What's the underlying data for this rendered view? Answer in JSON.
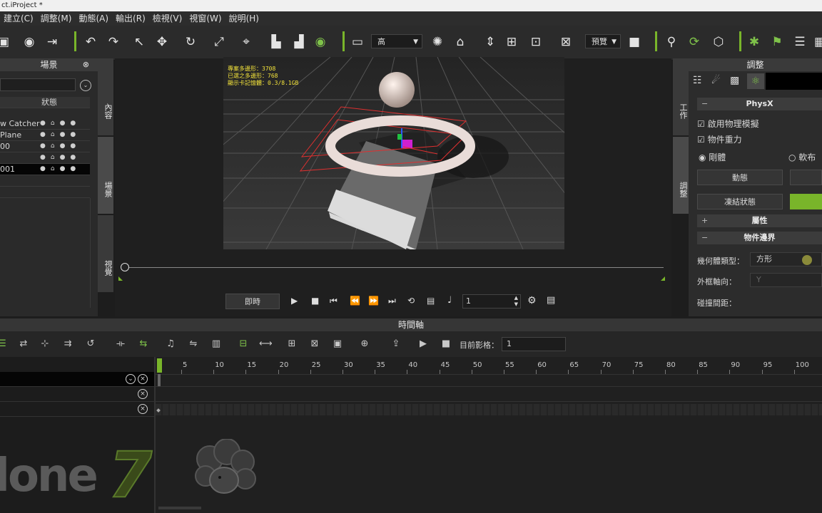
{
  "window": {
    "title": "ct.iProject *"
  },
  "menu": [
    "建立(C)",
    "調整(M)",
    "動態(A)",
    "輸出(R)",
    "檢視(V)",
    "視窗(W)",
    "說明(H)"
  ],
  "toolbar": {
    "quality_combo": "高",
    "preview_combo": "預覽"
  },
  "scene": {
    "title": "場景",
    "col_status": "狀態",
    "rows": [
      "w Catcher",
      "Plane",
      "00",
      "",
      "001"
    ]
  },
  "side_tabs": {
    "left": [
      "內容",
      "場景",
      "視覺"
    ],
    "right": [
      "工作",
      "調整"
    ]
  },
  "viewport": {
    "stats": [
      "專案多邊形：3708",
      "已選之多邊形：768",
      "顯示卡記憶體：0.3/8.1GB"
    ]
  },
  "playback": {
    "mode_button": "即時",
    "frame": "1"
  },
  "props": {
    "title": "調整",
    "physx_section": "PhysX",
    "enable_physics": "啟用物理模擬",
    "object_gravity": "物件重力",
    "rigid": "剛體",
    "soft": "軟布",
    "dynamic_button": "動態",
    "freeze_button": "凍結狀態",
    "attributes_section": "屬性",
    "bounds_section": "物件邊界",
    "geom_type_label": "幾何體類型：",
    "geom_type_value": "方形",
    "axis_label": "外框軸向：",
    "axis_value": "Y",
    "margin_label": "碰撞間距："
  },
  "timeline": {
    "title": "時間軸",
    "current_frame_label": "目前影格：",
    "current_frame_value": "1",
    "ticks": [
      "5",
      "10",
      "15",
      "20",
      "25",
      "30",
      "35",
      "40",
      "45",
      "50",
      "55",
      "60",
      "65",
      "70",
      "75",
      "80",
      "85",
      "90",
      "95",
      "100"
    ]
  },
  "brand": {
    "logo_text": "lone",
    "logo_number": "7"
  },
  "colors": {
    "accent": "#79b52a",
    "selection": "#000000"
  }
}
